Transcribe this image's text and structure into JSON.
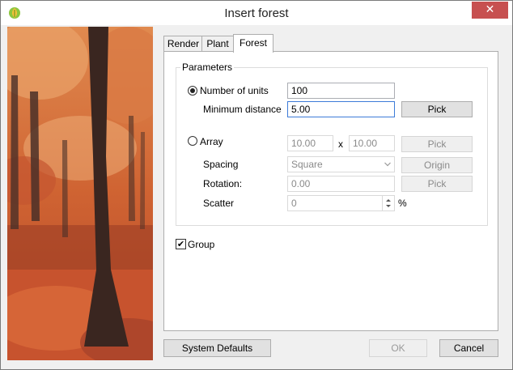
{
  "window": {
    "title": "Insert forest",
    "close_icon": "close-icon"
  },
  "tabs": [
    {
      "label": "Render",
      "active": false
    },
    {
      "label": "Plant",
      "active": false
    },
    {
      "label": "Forest",
      "active": true
    }
  ],
  "parameters": {
    "legend": "Parameters",
    "number_of_units": {
      "label": "Number of units",
      "value": "100",
      "selected": true
    },
    "minimum_distance": {
      "label": "Minimum distance",
      "value": "5.00",
      "pick_label": "Pick"
    },
    "array": {
      "label": "Array",
      "selected": false,
      "x_value": "10.00",
      "separator": "x",
      "y_value": "10.00",
      "pick_label": "Pick"
    },
    "spacing": {
      "label": "Spacing",
      "value": "Square",
      "origin_label": "Origin"
    },
    "rotation": {
      "label": "Rotation:",
      "value": "0.00",
      "pick_label": "Pick"
    },
    "scatter": {
      "label": "Scatter",
      "value": "0",
      "unit": "%"
    }
  },
  "group": {
    "label": "Group",
    "checked": true,
    "check_mark": "✔"
  },
  "footer": {
    "system_defaults_label": "System Defaults",
    "ok_label": "OK",
    "cancel_label": "Cancel"
  },
  "colors": {
    "close_button": "#c75050",
    "focus_border": "#3d7bd8",
    "foliage": "#d2693a"
  }
}
